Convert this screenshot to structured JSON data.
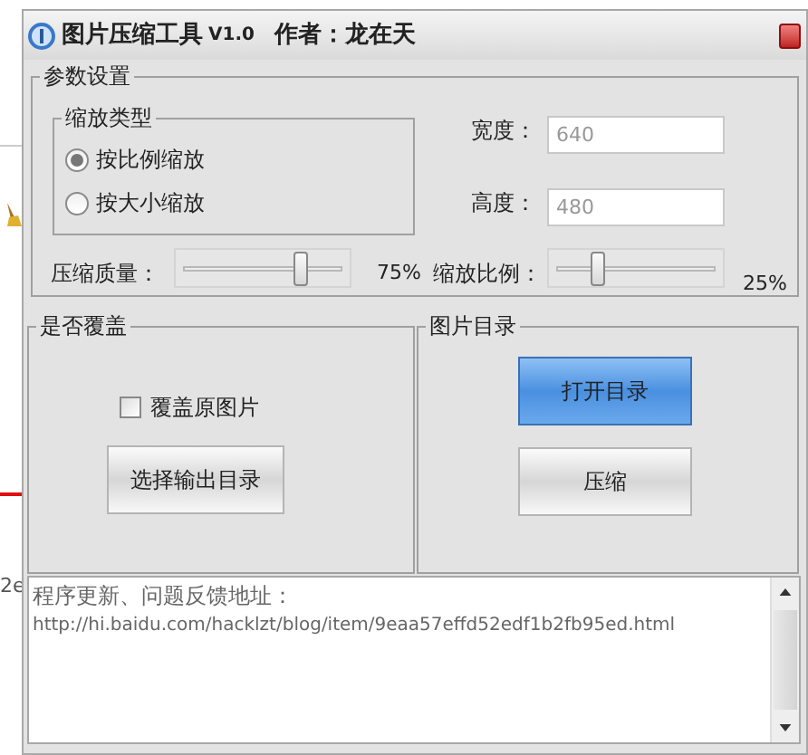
{
  "background_window": {
    "text": "2e"
  },
  "window": {
    "title": "图片压缩工具",
    "version": "V1.0",
    "author": "作者：龙在天"
  },
  "params_group": {
    "title": "参数设置",
    "scale_type": {
      "title": "缩放类型",
      "options": [
        {
          "label": "按比例缩放",
          "selected": true
        },
        {
          "label": "按大小缩放",
          "selected": false
        }
      ]
    },
    "width": {
      "label": "宽度：",
      "value": "640",
      "disabled": true
    },
    "height": {
      "label": "高度：",
      "value": "480",
      "disabled": true
    },
    "sliders": [
      {
        "label": "压缩质量：",
        "level": 0.75,
        "reading": "75%"
      },
      {
        "label": "缩放比例：",
        "level": 0.25,
        "reading": "25%"
      }
    ]
  },
  "overwrite_group": {
    "title": "是否覆盖",
    "checkbox": {
      "label": "覆盖原图片",
      "checked": false
    },
    "button": "选择输出目录"
  },
  "dir_group": {
    "title": "图片目录",
    "buttons": [
      {
        "label": "打开目录",
        "selected": true
      },
      {
        "label": "压缩",
        "selected": false
      }
    ]
  },
  "log": {
    "lines": [
      "程序更新、问题反馈地址：",
      "http://hi.baidu.com/hacklzt/blog/item/9eaa57effd52edf1b2fb95ed.html"
    ]
  }
}
